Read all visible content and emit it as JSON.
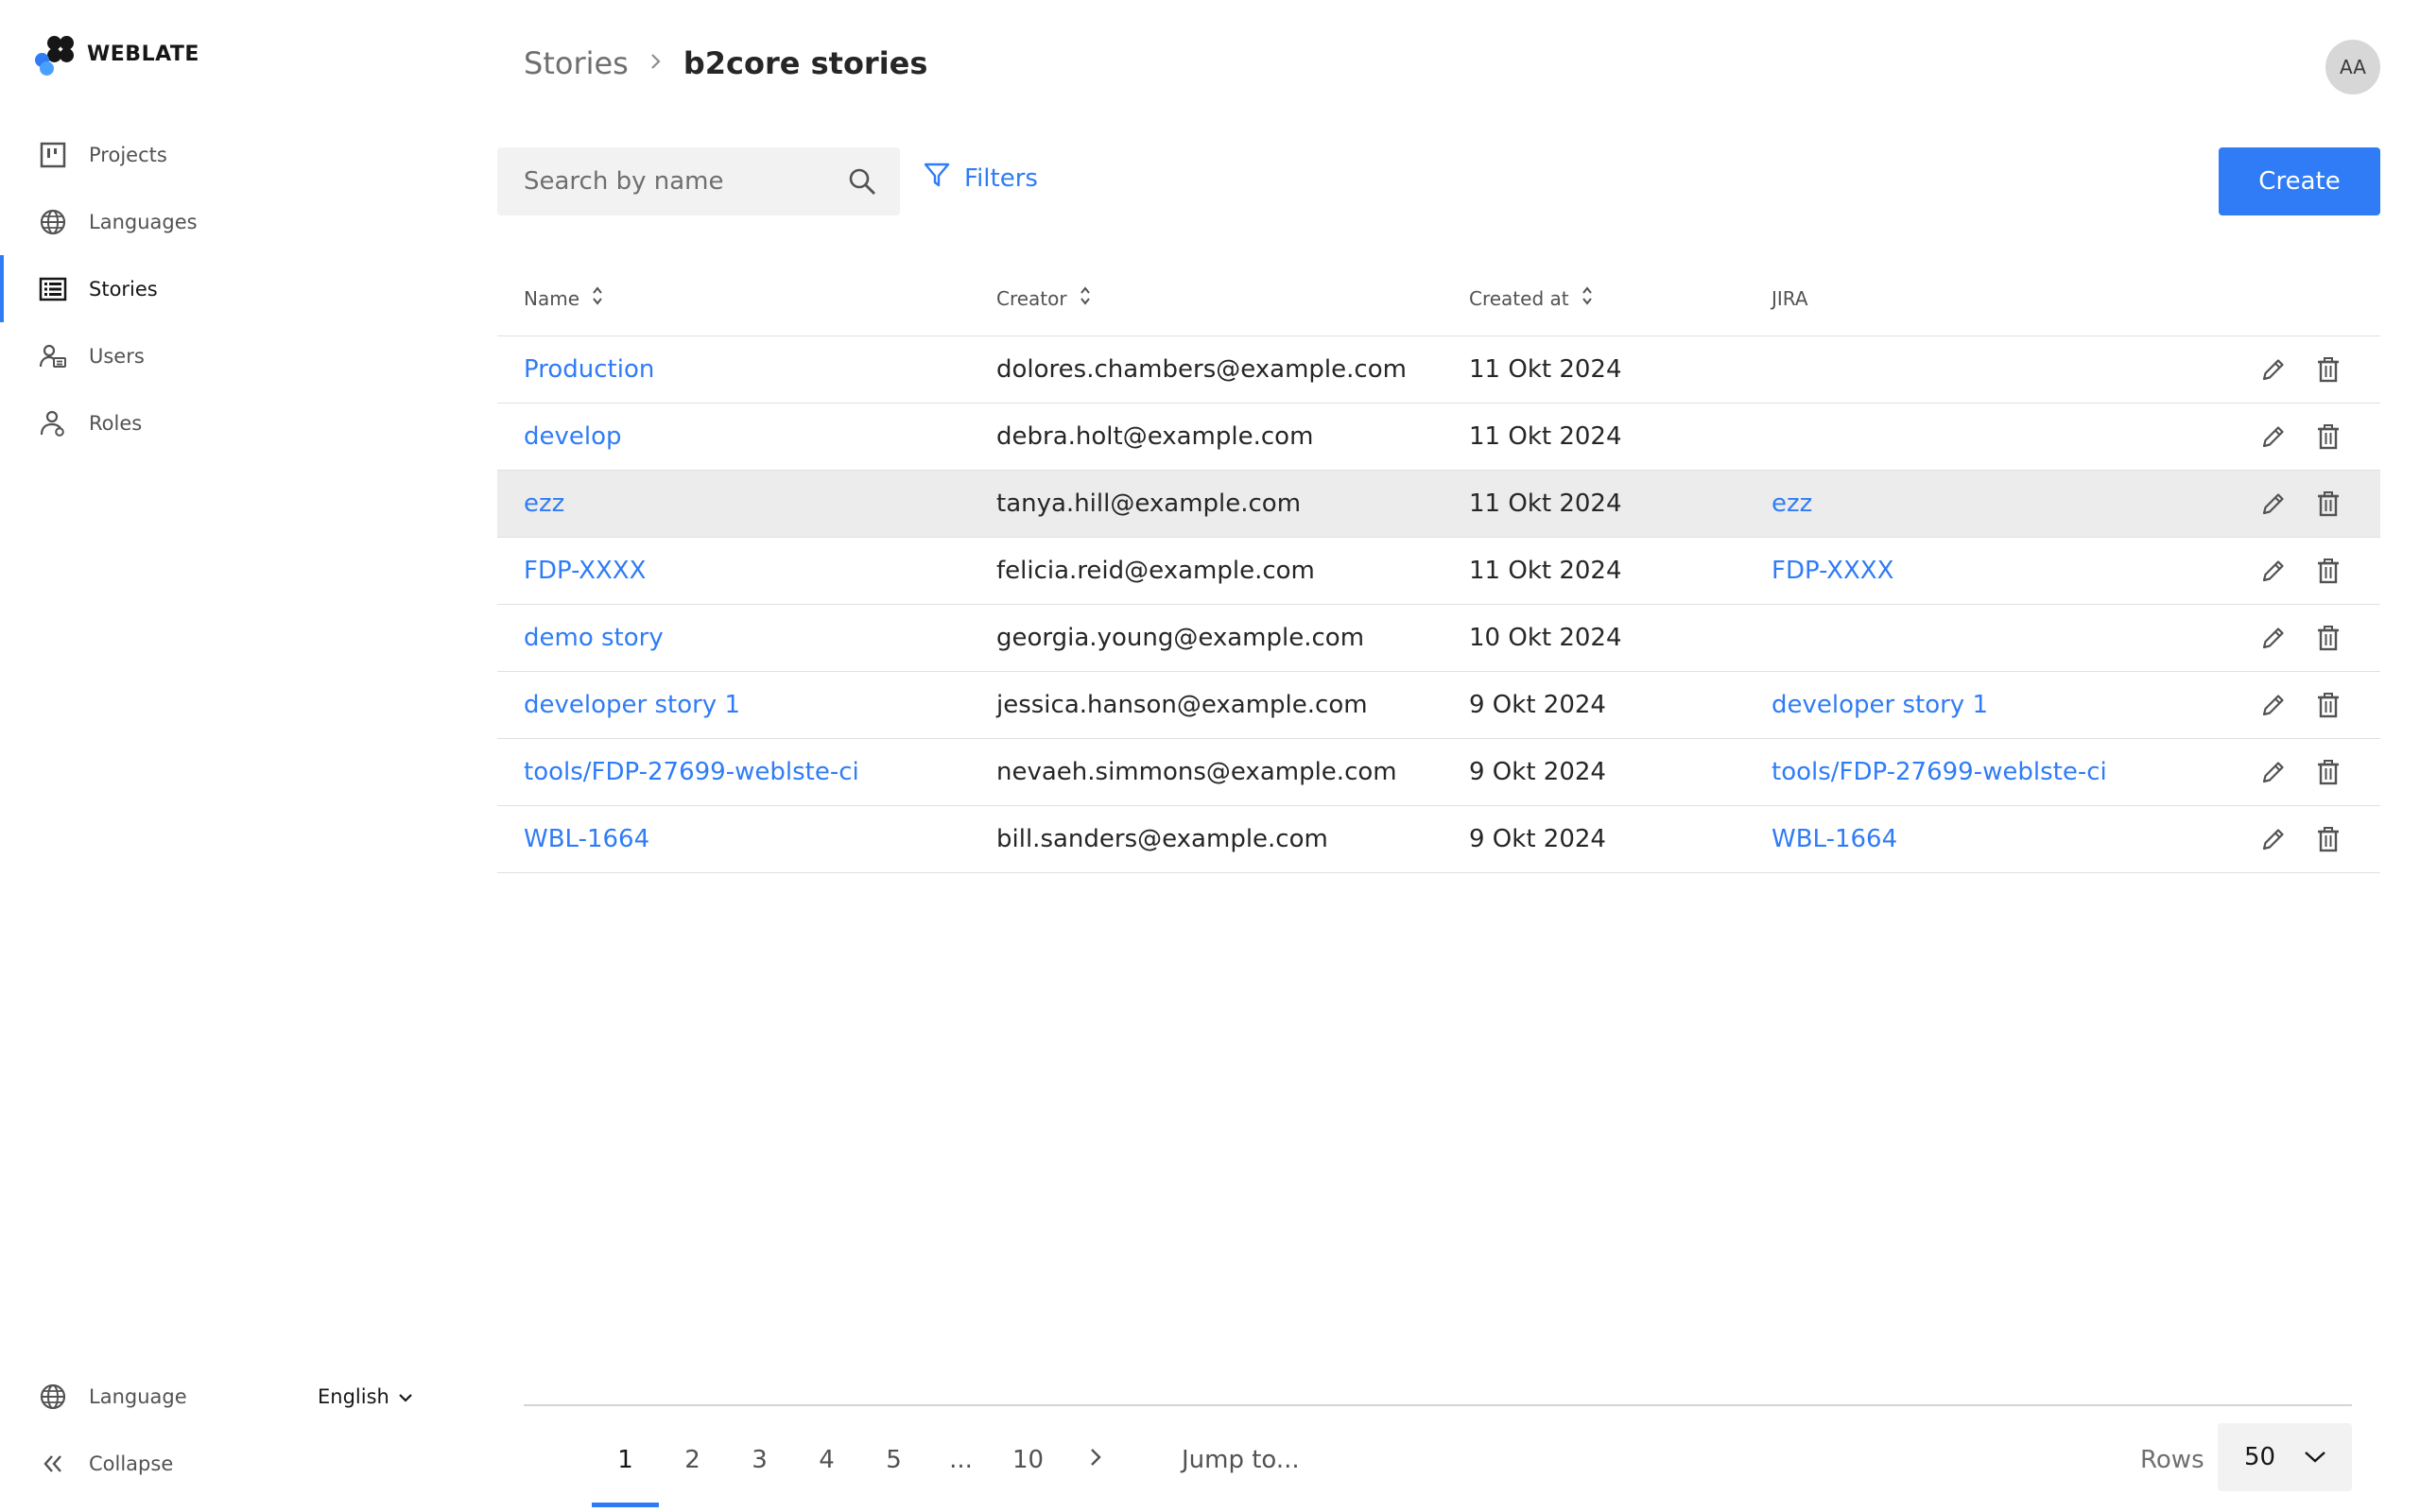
{
  "app": {
    "name": "WEBLATE"
  },
  "sidebar": {
    "items": [
      {
        "label": "Projects",
        "icon": "projects-icon"
      },
      {
        "label": "Languages",
        "icon": "globe-icon"
      },
      {
        "label": "Stories",
        "icon": "stories-icon",
        "active": true
      },
      {
        "label": "Users",
        "icon": "users-icon"
      },
      {
        "label": "Roles",
        "icon": "roles-icon"
      }
    ],
    "language_label": "Language",
    "language_value": "English",
    "collapse_label": "Collapse"
  },
  "header": {
    "breadcrumb_parent": "Stories",
    "breadcrumb_current": "b2core stories",
    "avatar_initials": "AA"
  },
  "toolbar": {
    "search_placeholder": "Search by name",
    "filters_label": "Filters",
    "create_label": "Create"
  },
  "table": {
    "columns": {
      "name": "Name",
      "creator": "Creator",
      "created_at": "Created at",
      "jira": "JIRA"
    },
    "rows": [
      {
        "name": "Production",
        "creator": "dolores.chambers@example.com",
        "created_at": "11 Okt 2024",
        "jira": ""
      },
      {
        "name": "develop",
        "creator": "debra.holt@example.com",
        "created_at": "11 Okt 2024",
        "jira": ""
      },
      {
        "name": "ezz",
        "creator": "tanya.hill@example.com",
        "created_at": "11 Okt 2024",
        "jira": "ezz"
      },
      {
        "name": "FDP-XXXX",
        "creator": "felicia.reid@example.com",
        "created_at": "11 Okt 2024",
        "jira": "FDP-XXXX"
      },
      {
        "name": "demo story",
        "creator": "georgia.young@example.com",
        "created_at": "10 Okt 2024",
        "jira": ""
      },
      {
        "name": "developer story 1",
        "creator": "jessica.hanson@example.com",
        "created_at": "9 Okt 2024",
        "jira": "developer story 1"
      },
      {
        "name": "tools/FDP-27699-weblste-ci",
        "creator": "nevaeh.simmons@example.com",
        "created_at": "9 Okt 2024",
        "jira": "tools/FDP-27699-weblste-ci"
      },
      {
        "name": "WBL-1664",
        "creator": "bill.sanders@example.com",
        "created_at": "9 Okt 2024",
        "jira": "WBL-1664"
      }
    ]
  },
  "pagination": {
    "pages": [
      "1",
      "2",
      "3",
      "4",
      "5",
      "...",
      "10"
    ],
    "current": "1",
    "jump_placeholder": "Jump to...",
    "rows_label": "Rows",
    "rows_value": "50"
  },
  "colors": {
    "accent": "#2f7cf6",
    "hover_row": "#ececec"
  }
}
